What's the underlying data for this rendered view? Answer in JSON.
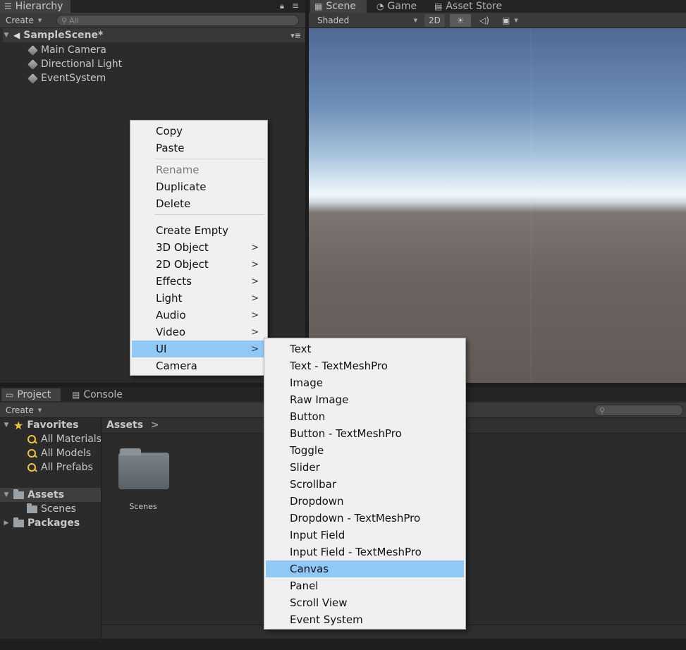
{
  "hierarchy": {
    "tab_label": "Hierarchy",
    "create_label": "Create",
    "search_placeholder": "All",
    "scene_name": "SampleScene*",
    "items": [
      "Main Camera",
      "Directional Light",
      "EventSystem"
    ]
  },
  "scene_tabs": {
    "scene": "Scene",
    "game": "Game",
    "asset_store": "Asset Store",
    "shading_mode": "Shaded",
    "mode_2d": "2D"
  },
  "context_menu": {
    "items": [
      {
        "label": "Copy"
      },
      {
        "label": "Paste"
      },
      {
        "label": "Rename",
        "disabled": true
      },
      {
        "label": "Duplicate"
      },
      {
        "label": "Delete"
      },
      {
        "label": "Create Empty"
      },
      {
        "label": "3D Object",
        "submenu": true
      },
      {
        "label": "2D Object",
        "submenu": true
      },
      {
        "label": "Effects",
        "submenu": true
      },
      {
        "label": "Light",
        "submenu": true
      },
      {
        "label": "Audio",
        "submenu": true
      },
      {
        "label": "Video",
        "submenu": true
      },
      {
        "label": "UI",
        "submenu": true,
        "highlighted": true
      },
      {
        "label": "Camera"
      }
    ],
    "submenu_arrow": ">"
  },
  "ui_submenu": {
    "items": [
      "Text",
      "Text - TextMeshPro",
      "Image",
      "Raw Image",
      "Button",
      "Button - TextMeshPro",
      "Toggle",
      "Slider",
      "Scrollbar",
      "Dropdown",
      "Dropdown - TextMeshPro",
      "Input Field",
      "Input Field - TextMeshPro",
      "Canvas",
      "Panel",
      "Scroll View",
      "Event System"
    ],
    "highlighted": "Canvas"
  },
  "project": {
    "tab_label": "Project",
    "console_tab_label": "Console",
    "create_label": "Create",
    "favorites_label": "Favorites",
    "favorites": [
      "All Materials",
      "All Models",
      "All Prefabs"
    ],
    "assets_label": "Assets",
    "assets_children": [
      "Scenes"
    ],
    "packages_label": "Packages",
    "breadcrumb": "Assets",
    "breadcrumb_arrow": ">",
    "folders": [
      "Scenes"
    ]
  },
  "colors": {
    "menu_highlight": "#90c8f6",
    "menu_bg": "#f0f0f0",
    "editor_bg": "#2b2b2b"
  }
}
